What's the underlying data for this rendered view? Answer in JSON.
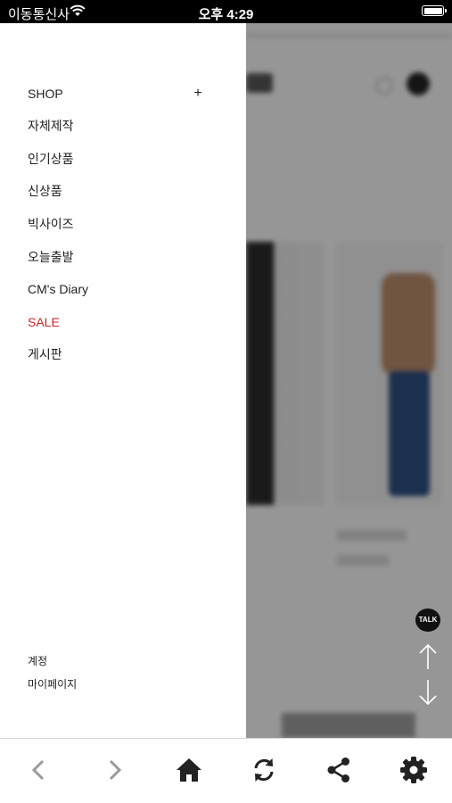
{
  "status_bar": {
    "carrier": "이동통신사",
    "time": "오후 4:29"
  },
  "drawer": {
    "menu_items": [
      {
        "label": "SHOP",
        "has_expand": true
      },
      {
        "label": "자체제작"
      },
      {
        "label": "인기상품"
      },
      {
        "label": "신상품"
      },
      {
        "label": "빅사이즈"
      },
      {
        "label": "오늘출발"
      },
      {
        "label": "CM's Diary"
      },
      {
        "label": "SALE",
        "color": "#c62828"
      },
      {
        "label": "게시판"
      }
    ],
    "expand_symbol": "+",
    "account_label": "계정",
    "mypage_label": "마이페이지"
  },
  "floating": {
    "talk_label": "TALK"
  },
  "toolbar": {
    "icons": [
      "back-icon",
      "forward-icon",
      "home-icon",
      "refresh-icon",
      "share-icon",
      "settings-icon"
    ]
  },
  "colors": {
    "sale": "#c62828",
    "toolbar_icon": "#222222",
    "toolbar_icon_disabled": "#9a9a9a"
  }
}
